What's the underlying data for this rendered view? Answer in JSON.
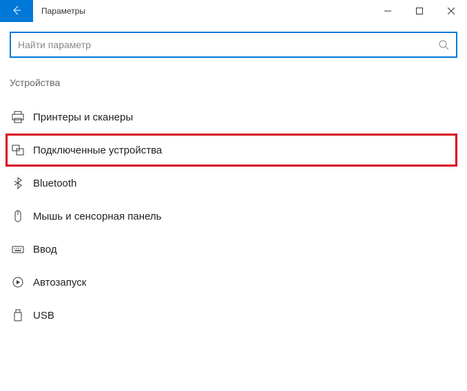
{
  "window": {
    "title": "Параметры"
  },
  "search": {
    "placeholder": "Найти параметр"
  },
  "section": {
    "title": "Устройства"
  },
  "nav": {
    "items": [
      {
        "icon": "printer-icon",
        "label": "Принтеры и сканеры",
        "highlighted": false
      },
      {
        "icon": "connected-icon",
        "label": "Подключенные устройства",
        "highlighted": true
      },
      {
        "icon": "bluetooth-icon",
        "label": "Bluetooth",
        "highlighted": false
      },
      {
        "icon": "mouse-icon",
        "label": "Мышь и сенсорная панель",
        "highlighted": false
      },
      {
        "icon": "keyboard-icon",
        "label": "Ввод",
        "highlighted": false
      },
      {
        "icon": "autoplay-icon",
        "label": "Автозапуск",
        "highlighted": false
      },
      {
        "icon": "usb-icon",
        "label": "USB",
        "highlighted": false
      }
    ]
  }
}
